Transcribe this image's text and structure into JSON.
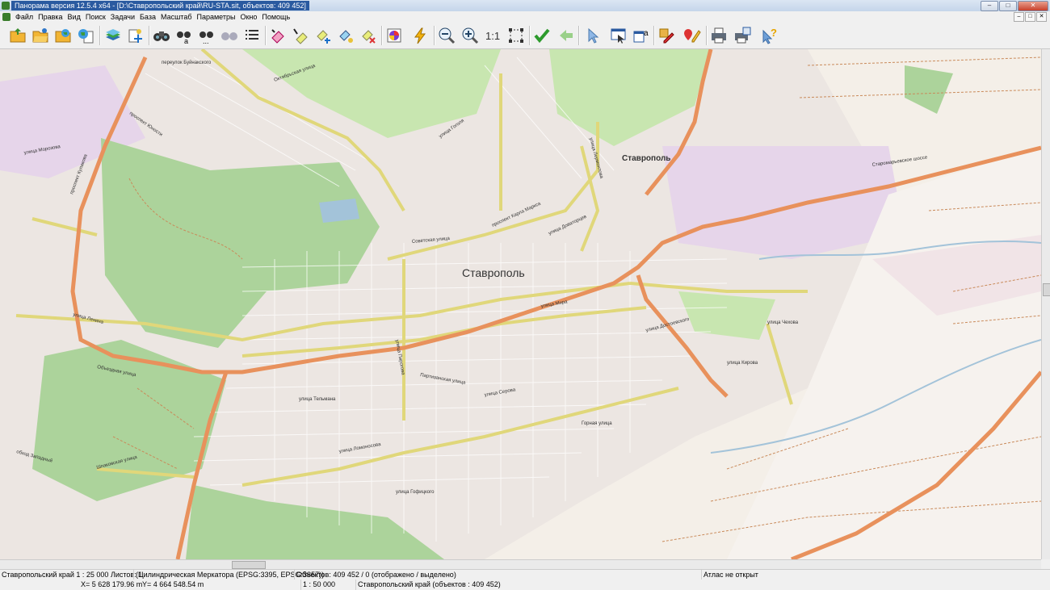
{
  "titlebar": {
    "title": "Панорама версия 12.5.4 x64 - [D:\\Ставропольский край\\RU-STA.sit, объектов: 409 452]",
    "buttons": [
      "–",
      "□",
      "✕"
    ]
  },
  "menubar": {
    "items": [
      "Файл",
      "Правка",
      "Вид",
      "Поиск",
      "Задачи",
      "База",
      "Масштаб",
      "Параметры",
      "Окно",
      "Помощь"
    ],
    "mdi_buttons": [
      "–",
      "□",
      "✕"
    ]
  },
  "toolbar": {
    "scale_label": "1:1",
    "icons": [
      "open-icon",
      "open-folder-icon",
      "map-folder-icon",
      "globe-doc-icon",
      "layers-icon",
      "add-layer-icon",
      "binoculars-icon",
      "binoculars-a-icon",
      "binoculars-dots-icon",
      "binoculars-disabled-icon",
      "list-icon",
      "eraser-icon",
      "eraser-select-icon",
      "eraser-add-icon",
      "eraser-dots-icon",
      "eraser-remove-icon",
      "color-box-icon",
      "lightning-icon",
      "zoom-out-icon",
      "zoom-in-icon",
      "fit-window-icon",
      "check-icon",
      "back-icon",
      "pointer-icon",
      "window-select-icon",
      "text-window-icon",
      "pencil-icon",
      "map-pencil-icon",
      "printer-icon",
      "printer-preview-icon",
      "help-pointer-icon"
    ]
  },
  "map": {
    "city_label": "Ставрополь",
    "city_label_blue": "Ставрополь",
    "streets": [
      "Октябрьская улица",
      "проспект Кулакова",
      "переулок Буйнакского",
      "проспект Юности",
      "улица Гоголя",
      "улица Лермонтова",
      "Советская улица",
      "проспект Карла Маркса",
      "улица Доваторцев",
      "улица Мира",
      "улица Ленина",
      "Объездная улица",
      "улица Пирогова",
      "улица Достоевского",
      "Партизанская улица",
      "улица Серова",
      "Шпаковская улица",
      "улица Тельмана",
      "улица Ломоносова",
      "улица Гофицкого",
      "Горная улица",
      "Старомарьевское шоссе",
      "обход Западный",
      "улица Чехова",
      "улица Кирова",
      "улица Морозова"
    ],
    "colors": {
      "residential": "#ece6e2",
      "forest": "#acd39b",
      "park": "#c8e6b0",
      "industrial": "#e6d5ea",
      "primary_road": "#e8915c",
      "secondary_road": "#f2ed9a",
      "river": "#a3c3d9"
    }
  },
  "status": {
    "region_scale": "Ставропольский край  1 : 25 000  Листов: 1",
    "projection": "(Цилиндрическая Меркатора (EPSG:3395, EPSG:3857))",
    "objects": "Объектов: 409 452 / 0 (отображено / выделено)",
    "atlas": "Атлас не открыт",
    "x_coord": "X= 5 628 179.96 m",
    "y_coord": "Y= 4 664 548.54 m",
    "scale2": "1 : 50 000",
    "region_objects": "Ставропольский край   (объектов : 409 452)"
  }
}
